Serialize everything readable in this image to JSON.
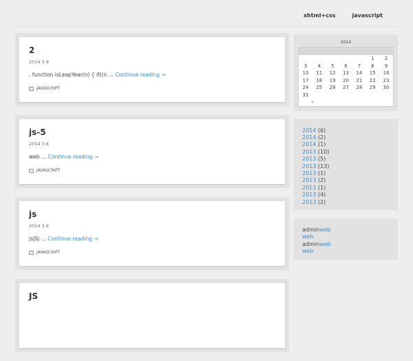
{
  "site": {
    "title": ""
  },
  "nav": {
    "items": [
      "",
      "xhtml+css",
      "javascript",
      ""
    ]
  },
  "posts": [
    {
      "title": "2",
      "date": "2014  3  9 ",
      "excerpt": ", function isLeapYear(n) { if((n …",
      "more": "Continue reading →",
      "category": "JAVASCRIPT"
    },
    {
      "title": "js-5",
      "date": "2014  3  6 ",
      "excerpt": "web …",
      "more": "Continue reading →",
      "category": "JAVASCRIPT"
    },
    {
      "title": "js",
      "date": "2014  3  6 ",
      "excerpt": "jsJSj …",
      "more": "Continue reading →",
      "category": "JAVASCRIPT"
    },
    {
      "title": "JS",
      "date": "",
      "excerpt": "",
      "more": "",
      "category": ""
    }
  ],
  "calendar": {
    "caption": "2014",
    "weekdays": [
      "",
      "",
      "",
      "",
      "",
      "",
      ""
    ],
    "rows": [
      [
        "",
        "",
        "",
        "",
        "",
        "1",
        "2"
      ],
      [
        "3",
        "4",
        "5",
        "6",
        "7",
        "8",
        "9"
      ],
      [
        "10",
        "11",
        "12",
        "13",
        "14",
        "15",
        "16"
      ],
      [
        "17",
        "18",
        "19",
        "20",
        "21",
        "22",
        "23"
      ],
      [
        "24",
        "25",
        "26",
        "27",
        "28",
        "29",
        "30"
      ],
      [
        "31",
        "",
        "",
        "",
        "",
        "",
        ""
      ]
    ],
    "prev": "« "
  },
  "archives": {
    "title": "",
    "items": [
      {
        "label": "2014",
        "count": "(6)"
      },
      {
        "label": "2014",
        "count": "(2)"
      },
      {
        "label": "2014",
        "count": "(1)"
      },
      {
        "label": "2013",
        "count": "(10)"
      },
      {
        "label": "2013",
        "count": "(5)"
      },
      {
        "label": "2013",
        "count": "(13)"
      },
      {
        "label": "2013",
        "count": "(1)"
      },
      {
        "label": "2013",
        "count": "(2)"
      },
      {
        "label": "2013",
        "count": "(1)"
      },
      {
        "label": "2013",
        "count": "(4)"
      },
      {
        "label": "2013",
        "count": "(2)"
      }
    ]
  },
  "recent_comments": {
    "title": "",
    "items": [
      {
        "author": "admin",
        "sep": "",
        "link": "web"
      },
      {
        "author": "",
        "sep": "",
        "link": "web"
      },
      {
        "author": "admin",
        "sep": "",
        "link": "web"
      },
      {
        "author": "",
        "sep": "",
        "link": "web"
      }
    ]
  }
}
